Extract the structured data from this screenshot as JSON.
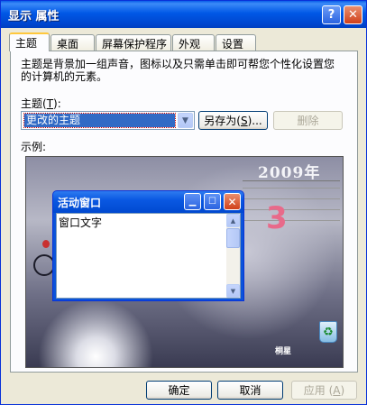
{
  "window": {
    "title": "显示 属性",
    "help_glyph": "?",
    "close_glyph": "✕"
  },
  "tabs": [
    "主题",
    "桌面",
    "屏幕保护程序",
    "外观",
    "设置"
  ],
  "theme_tab": {
    "description": "主题是背景加一组声音，图标以及只需单击即可帮您个性化设置您的计算机的元素。",
    "theme_label": "主题",
    "theme_hotkey": "T",
    "theme_value": "更改的主题",
    "save_as_label": "另存为",
    "save_as_hotkey": "S",
    "delete_label": "删除",
    "sample_label": "示例:"
  },
  "preview": {
    "active_window_title": "活动窗口",
    "window_text": "窗口文字",
    "wallpaper_year": "2009年",
    "calendar_big_digit": "3",
    "logo_text": "桐星"
  },
  "footer": {
    "ok_label": "确定",
    "cancel_label": "取消",
    "apply_label": "应用",
    "apply_hotkey": "A"
  },
  "colors": {
    "titlebar": "#0054e3",
    "dialog_bg": "#ece9d8",
    "selection": "#316ac5",
    "active_tab_accent": "#ffc83c"
  }
}
